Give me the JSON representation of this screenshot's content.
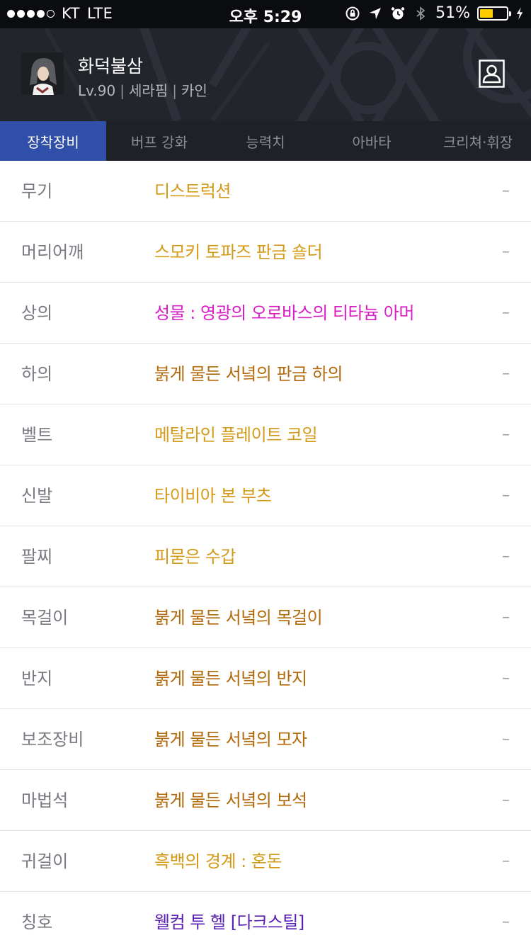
{
  "status_bar": {
    "carrier": "KT",
    "network": "LTE",
    "time": "오후 5:29",
    "battery_percent": "51%",
    "battery_level": 0.51,
    "signal_bars_filled": 4,
    "signal_bars_total": 5,
    "icons": [
      "orientation-lock-icon",
      "location-arrow-icon",
      "alarm-icon",
      "bluetooth-icon",
      "battery-icon",
      "charging-bolt-icon"
    ]
  },
  "character": {
    "name": "화덕불삼",
    "level": "Lv.90",
    "class": "세라핌",
    "server": "카인",
    "separator": "|"
  },
  "tabs": [
    {
      "label": "장착장비",
      "active": true
    },
    {
      "label": "버프 강화",
      "active": false
    },
    {
      "label": "능력치",
      "active": false
    },
    {
      "label": "아바타",
      "active": false
    },
    {
      "label": "크리쳐·휘장",
      "active": false
    }
  ],
  "equipment": [
    {
      "slot": "무기",
      "item": "디스트럭션",
      "color": "#d49a17",
      "value": "–"
    },
    {
      "slot": "머리어깨",
      "item": "스모키 토파즈 판금 숄더",
      "color": "#d49a17",
      "value": "–"
    },
    {
      "slot": "상의",
      "item": "성물 : 영광의 오로바스의 티타늄 아머",
      "color": "#d91ec7",
      "value": "–"
    },
    {
      "slot": "하의",
      "item": "붉게 물든 서녘의 판금 하의",
      "color": "#b2690a",
      "value": "–"
    },
    {
      "slot": "벨트",
      "item": "메탈라인 플레이트 코일",
      "color": "#d49a17",
      "value": "–"
    },
    {
      "slot": "신발",
      "item": "타이비아 본 부츠",
      "color": "#d49a17",
      "value": "–"
    },
    {
      "slot": "팔찌",
      "item": "피묻은 수갑",
      "color": "#d49a17",
      "value": "–"
    },
    {
      "slot": "목걸이",
      "item": "붉게 물든 서녘의 목걸이",
      "color": "#b2690a",
      "value": "–"
    },
    {
      "slot": "반지",
      "item": "붉게 물든 서녘의 반지",
      "color": "#b2690a",
      "value": "–"
    },
    {
      "slot": "보조장비",
      "item": "붉게 물든 서녘의 모자",
      "color": "#b2690a",
      "value": "–"
    },
    {
      "slot": "마법석",
      "item": "붉게 물든 서녘의 보석",
      "color": "#b2690a",
      "value": "–"
    },
    {
      "slot": "귀걸이",
      "item": "흑백의 경계 : 혼돈",
      "color": "#d49a17",
      "value": "–"
    },
    {
      "slot": "칭호",
      "item": "웰컴 투 헬 [다크스틸]",
      "color": "#5a1fb3",
      "value": "–"
    }
  ],
  "colors": {
    "header_bg": "#23252c",
    "tab_active": "#2f4fa8",
    "tab_bar": "#1f2128",
    "battery_fill": "#ffcc00"
  }
}
